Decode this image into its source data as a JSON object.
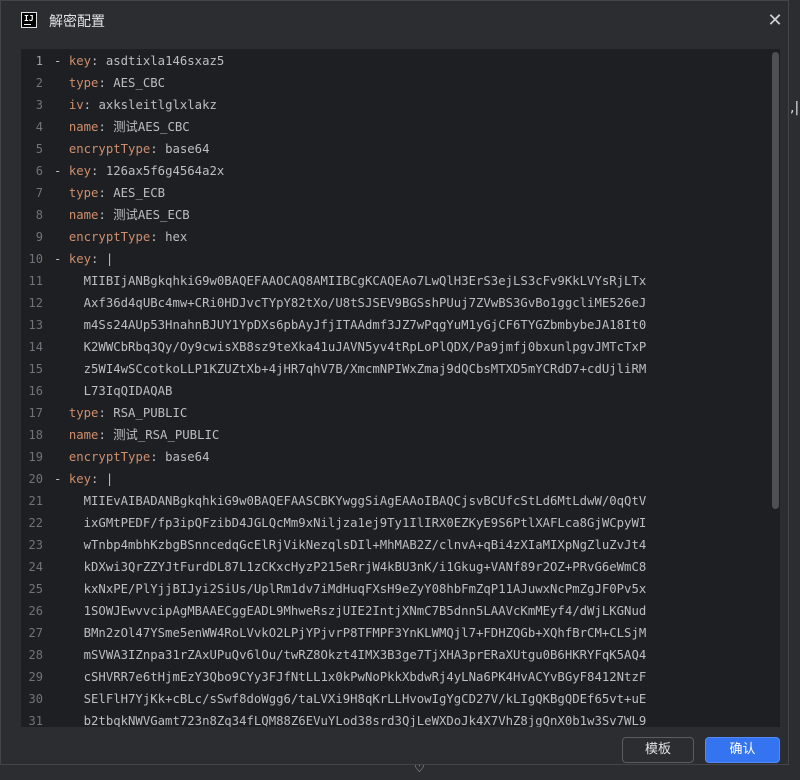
{
  "dialog": {
    "title": "解密配置",
    "close_glyph": "✕",
    "buttons": {
      "template": "模板",
      "confirm": "确认"
    }
  },
  "editor": {
    "lines": [
      {
        "n": "1",
        "dash": "- ",
        "key": "key",
        "sep": ": ",
        "value": "asdtixla146sxaz5"
      },
      {
        "n": "2",
        "dash": "  ",
        "key": "type",
        "sep": ": ",
        "value": "AES_CBC"
      },
      {
        "n": "3",
        "dash": "  ",
        "key": "iv",
        "sep": ": ",
        "value": "axksleitlglxlakz"
      },
      {
        "n": "4",
        "dash": "  ",
        "key": "name",
        "sep": ": ",
        "value": "测试AES_CBC"
      },
      {
        "n": "5",
        "dash": "  ",
        "key": "encryptType",
        "sep": ": ",
        "value": "base64"
      },
      {
        "n": "6",
        "dash": "- ",
        "key": "key",
        "sep": ": ",
        "value": "126ax5f6g4564a2x"
      },
      {
        "n": "7",
        "dash": "  ",
        "key": "type",
        "sep": ": ",
        "value": "AES_ECB"
      },
      {
        "n": "8",
        "dash": "  ",
        "key": "name",
        "sep": ": ",
        "value": "测试AES_ECB"
      },
      {
        "n": "9",
        "dash": "  ",
        "key": "encryptType",
        "sep": ": ",
        "value": "hex"
      },
      {
        "n": "10",
        "dash": "- ",
        "key": "key",
        "sep": ": ",
        "value": "|"
      },
      {
        "n": "11",
        "dash": "",
        "key": "",
        "sep": "",
        "value": "    MIIBIjANBgkqhkiG9w0BAQEFAAOCAQ8AMIIBCgKCAQEAo7LwQlH3ErS3ejLS3cFv9KkLVYsRjLTx"
      },
      {
        "n": "12",
        "dash": "",
        "key": "",
        "sep": "",
        "value": "    Axf36d4qUBc4mw+CRi0HDJvcTYpY82tXo/U8tSJSEV9BGSshPUuj7ZVwBS3GvBo1ggcliME526eJ"
      },
      {
        "n": "13",
        "dash": "",
        "key": "",
        "sep": "",
        "value": "    m4Ss24AUp53HnahnBJUY1YpDXs6pbAyJfjITAAdmf3JZ7wPqgYuM1yGjCF6TYGZbmbybeJA18It0"
      },
      {
        "n": "14",
        "dash": "",
        "key": "",
        "sep": "",
        "value": "    K2WWCbRbq3Qy/Oy9cwisXB8sz9teXka41uJAVN5yv4tRpLoPlQDX/Pa9jmfj0bxunlpgvJMTcTxP"
      },
      {
        "n": "15",
        "dash": "",
        "key": "",
        "sep": "",
        "value": "    z5WI4wSCcotkoLLP1KZUZtXb+4jHR7qhV7B/XmcmNPIWxZmaj9dQCbsMTXD5mYCRdD7+cdUjliRM"
      },
      {
        "n": "16",
        "dash": "",
        "key": "",
        "sep": "",
        "value": "    L73IqQIDAQAB"
      },
      {
        "n": "17",
        "dash": "  ",
        "key": "type",
        "sep": ": ",
        "value": "RSA_PUBLIC"
      },
      {
        "n": "18",
        "dash": "  ",
        "key": "name",
        "sep": ": ",
        "value": "测试_RSA_PUBLIC"
      },
      {
        "n": "19",
        "dash": "  ",
        "key": "encryptType",
        "sep": ": ",
        "value": "base64"
      },
      {
        "n": "20",
        "dash": "- ",
        "key": "key",
        "sep": ": ",
        "value": "|"
      },
      {
        "n": "21",
        "dash": "",
        "key": "",
        "sep": "",
        "value": "    MIIEvAIBADANBgkqhkiG9w0BAQEFAASCBKYwggSiAgEAAoIBAQCjsvBCUfcStLd6MtLdwW/0qQtV"
      },
      {
        "n": "22",
        "dash": "",
        "key": "",
        "sep": "",
        "value": "    ixGMtPEDF/fp3ipQFzibD4JGLQcMm9xNiljza1ej9Ty1IlIRX0EZKyE9S6PtlXAFLca8GjWCpyWI"
      },
      {
        "n": "23",
        "dash": "",
        "key": "",
        "sep": "",
        "value": "    wTnbp4mbhKzbgBSnncedqGcElRjVikNezqlsDIl+MhMAB2Z/clnvA+qBi4zXIaMIXpNgZluZvJt4"
      },
      {
        "n": "24",
        "dash": "",
        "key": "",
        "sep": "",
        "value": "    kDXwi3QrZZYJtFurdDL87L1zCKxcHyzP215eRrjW4kBU3nK/i1Gkug+VANf89r2OZ+PRvG6eWmC8"
      },
      {
        "n": "25",
        "dash": "",
        "key": "",
        "sep": "",
        "value": "    kxNxPE/PlYjjBIJyi2SiUs/UplRm1dv7iMdHuqFXsH9eZyY08hbFmZqP11AJuwxNcPmZgJF0Pv5x"
      },
      {
        "n": "26",
        "dash": "",
        "key": "",
        "sep": "",
        "value": "    1SOWJEwvvcipAgMBAAECggEADL9MhweRszjUIE2IntjXNmC7B5dnn5LAAVcKmMEyf4/dWjLKGNud"
      },
      {
        "n": "27",
        "dash": "",
        "key": "",
        "sep": "",
        "value": "    BMn2zOl47YSme5enWW4RoLVvkO2LPjYPjvrP8TFMPF3YnKLWMQjl7+FDHZQGb+XQhfBrCM+CLSjM"
      },
      {
        "n": "28",
        "dash": "",
        "key": "",
        "sep": "",
        "value": "    mSVWA3IZnpa31rZAxUPuQv6lOu/twRZ8Okzt4IMX3B3ge7TjXHA3prERaXUtgu0B6HKRYFqK5AQ4"
      },
      {
        "n": "29",
        "dash": "",
        "key": "",
        "sep": "",
        "value": "    cSHVRR7e6tHjmEzY3Qbo9CYy3FJfNtLL1x0kPwNoPkkXbdwRj4yLNa6PK4HvACYvBGyF8412NtzF"
      },
      {
        "n": "30",
        "dash": "",
        "key": "",
        "sep": "",
        "value": "    SElFlH7YjKk+cBLc/sSwf8doWgg6/taLVXi9H8qKrLLHvowIgYgCD27V/kLIgQKBgQDEf65vt+uE"
      },
      {
        "n": "31",
        "dash": "",
        "key": "",
        "sep": "",
        "value": "    b2tbqkNWVGamt723n8Zq34fLQM88Z6EVuYLod38srd3QjLeWXDoJk4X7VhZ8jgQnX0b1w3Sv7WL9"
      }
    ]
  },
  "background": {
    "right_mark": ",|",
    "bottom_mark": "♡"
  }
}
